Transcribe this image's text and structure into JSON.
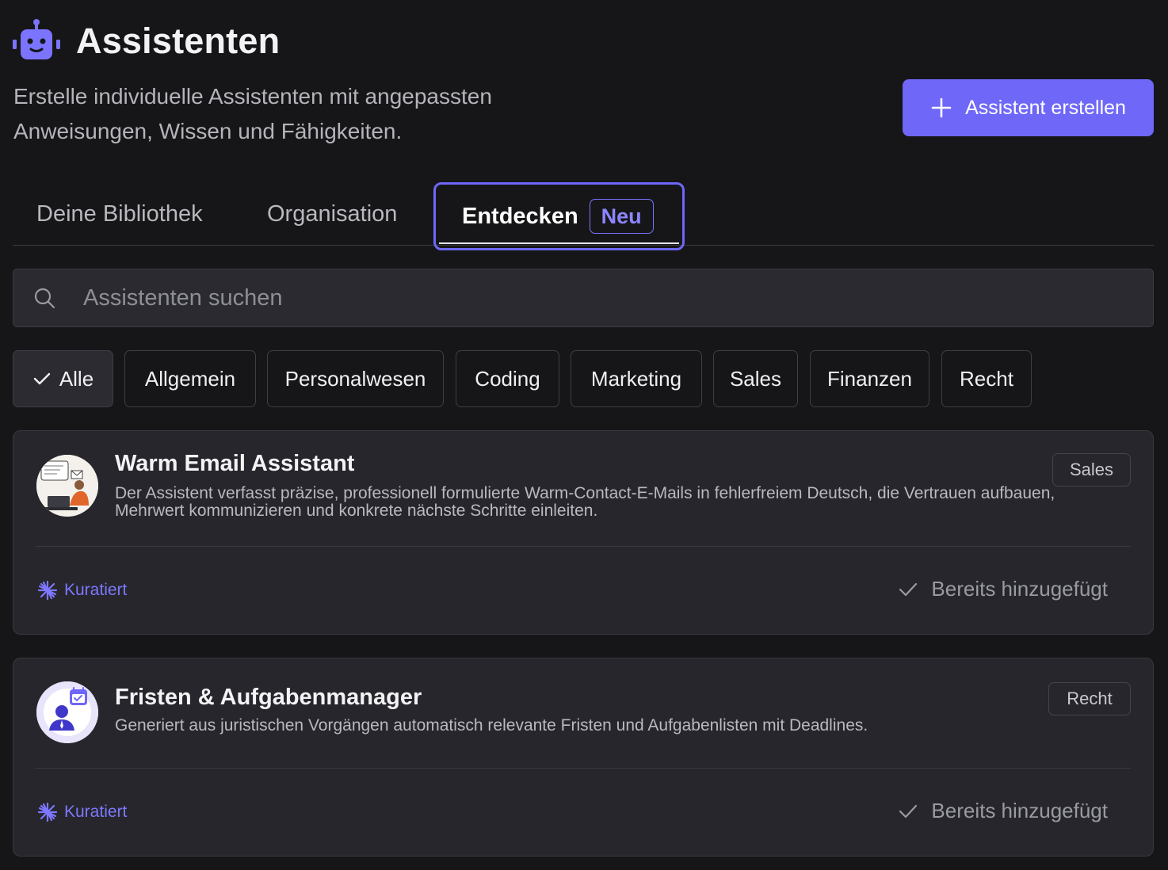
{
  "header": {
    "title": "Assistenten",
    "icon": "robot-icon",
    "subtitle": "Erstelle individuelle Assistenten mit angepassten Anweisungen, Wissen und Fähigkeiten.",
    "create_button": "Assistent erstellen"
  },
  "colors": {
    "accent": "#6e67f7",
    "background": "#161618",
    "card": "#26262c"
  },
  "tabs": [
    {
      "label": "Deine Bibliothek"
    },
    {
      "label": "Organisation"
    },
    {
      "label": "Entdecken",
      "badge": "Neu",
      "active": true
    }
  ],
  "search": {
    "placeholder": "Assistenten suchen",
    "value": ""
  },
  "filters": [
    {
      "label": "Alle",
      "active": true
    },
    {
      "label": "Allgemein"
    },
    {
      "label": "Personalwesen"
    },
    {
      "label": "Coding"
    },
    {
      "label": "Marketing"
    },
    {
      "label": "Sales"
    },
    {
      "label": "Finanzen"
    },
    {
      "label": "Recht"
    }
  ],
  "assistants": [
    {
      "title": "Warm Email Assistant",
      "description": "Der Assistent verfasst präzise, professionell formulierte Warm-Contact-E-Mails in fehlerfreiem Deutsch, die Vertrauen aufbauen, Mehrwert kommunizieren und konkrete nächste Schritte einleiten.",
      "category": "Sales",
      "curated_label": "Kuratiert",
      "status": "Bereits hinzugefügt",
      "avatar": "email-writer-illustration"
    },
    {
      "title": "Fristen & Aufgabenmanager",
      "description": "Generiert aus juristischen Vorgängen automatisch relevante Fristen und Aufgabenlisten mit Deadlines.",
      "category": "Recht",
      "curated_label": "Kuratiert",
      "status": "Bereits hinzugefügt",
      "avatar": "person-calendar-icon"
    }
  ]
}
